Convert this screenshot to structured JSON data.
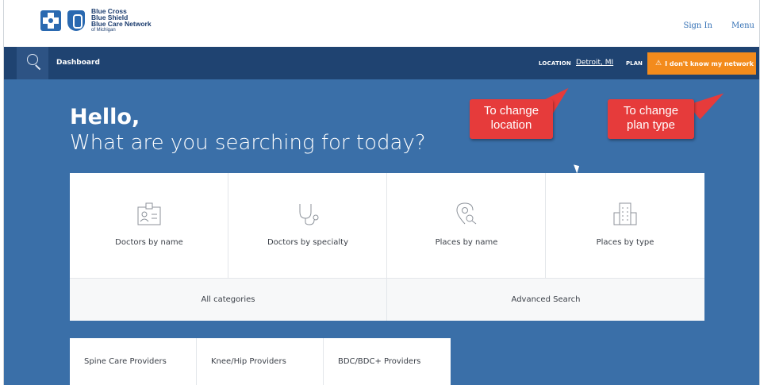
{
  "header": {
    "brand_lines": [
      "Blue Cross",
      "Blue Shield",
      "Blue Care Network",
      "of Michigan"
    ],
    "sign_in": "Sign In",
    "menu": "Menu"
  },
  "nav": {
    "dashboard": "Dashboard",
    "location_label": "LOCATION",
    "location_value": "Detroit, MI",
    "plan_label": "PLAN",
    "network_button": "I don't know my network",
    "search_icon": "search-icon",
    "warning_icon": "warning-icon"
  },
  "hero": {
    "greeting": "Hello,",
    "question": "What are you searching for today?"
  },
  "callouts": {
    "location": [
      "To change",
      "location"
    ],
    "plan": [
      "To change",
      "plan type"
    ]
  },
  "search_cards": [
    {
      "label": "Doctors by name",
      "icon": "id-badge-icon"
    },
    {
      "label": "Doctors by specialty",
      "icon": "stethoscope-icon"
    },
    {
      "label": "Places by name",
      "icon": "map-pin-search-icon"
    },
    {
      "label": "Places by type",
      "icon": "building-icon"
    }
  ],
  "secondary": {
    "all_categories": "All categories",
    "advanced_search": "Advanced Search"
  },
  "provider_tabs": [
    "Spine Care Providers",
    "Knee/Hip Providers",
    "BDC/BDC+ Providers"
  ],
  "colors": {
    "nav_bg": "#1f4371",
    "hero_bg": "#3a6fa8",
    "accent_orange": "#f38b1c",
    "callout_red": "#e63b3b",
    "link_blue": "#2f6db3"
  }
}
